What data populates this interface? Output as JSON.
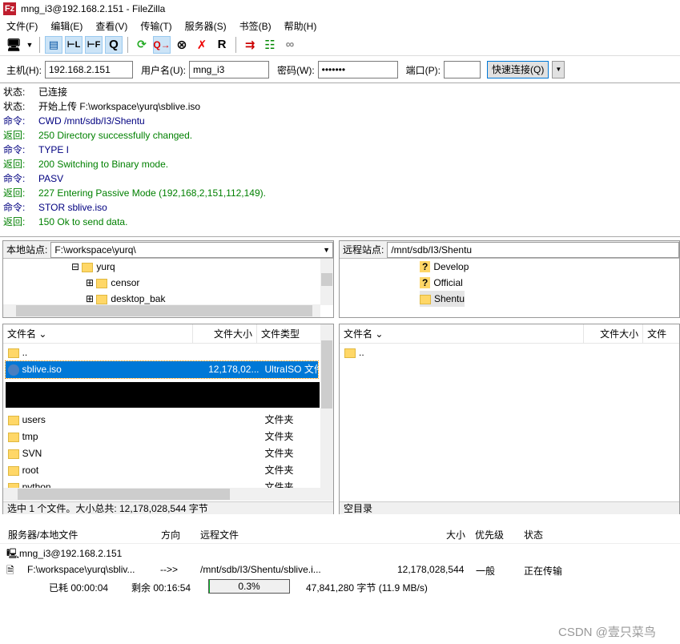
{
  "window": {
    "title": "mng_i3@192.168.2.151 - FileZilla",
    "logo": "Fz"
  },
  "menu": [
    "文件(F)",
    "编辑(E)",
    "查看(V)",
    "传输(T)",
    "服务器(S)",
    "书签(B)",
    "帮助(H)"
  ],
  "toolbar": {
    "icons": [
      "site-manager-icon",
      "dropdown-icon",
      "toggle-log-icon",
      "toggle-local-tree-icon",
      "toggle-remote-tree-icon",
      "toggle-queue-icon",
      "refresh-icon",
      "process-queue-icon",
      "cancel-icon",
      "disconnect-icon",
      "reconnect-icon",
      "compare-icon",
      "sync-browse-icon",
      "search-icon"
    ],
    "q_label": "Q",
    "r_label": "R"
  },
  "quickconnect": {
    "host_label": "主机(H):",
    "host": "192.168.2.151",
    "user_label": "用户名(U):",
    "user": "mng_i3",
    "pass_label": "密码(W):",
    "pass": "•••••••",
    "port_label": "端口(P):",
    "port": "",
    "button": "快速连接(Q)"
  },
  "log": [
    {
      "k": "状态:",
      "t": "已连接",
      "type": "status"
    },
    {
      "k": "状态:",
      "t": "开始上传 F:\\workspace\\yurq\\sblive.iso",
      "type": "status"
    },
    {
      "k": "命令:",
      "t": "CWD /mnt/sdb/I3/Shentu",
      "type": "cmd"
    },
    {
      "k": "返回:",
      "t": "250 Directory successfully changed.",
      "type": "ret"
    },
    {
      "k": "命令:",
      "t": "TYPE I",
      "type": "cmd"
    },
    {
      "k": "返回:",
      "t": "200 Switching to Binary mode.",
      "type": "ret"
    },
    {
      "k": "命令:",
      "t": "PASV",
      "type": "cmd"
    },
    {
      "k": "返回:",
      "t": "227 Entering Passive Mode (192,168,2,151,112,149).",
      "type": "ret"
    },
    {
      "k": "命令:",
      "t": "STOR sblive.iso",
      "type": "cmd"
    },
    {
      "k": "返回:",
      "t": "150 Ok to send data.",
      "type": "ret"
    }
  ],
  "local": {
    "site_label": "本地站点:",
    "path": "F:\\workspace\\yurq\\",
    "tree": [
      "yurq",
      "censor",
      "desktop_bak"
    ],
    "columns": [
      "文件名",
      "文件大小",
      "文件类型"
    ],
    "files": [
      {
        "name": "..",
        "size": "",
        "type": ""
      },
      {
        "name": "sblive.iso",
        "size": "12,178,02...",
        "type": "UltraISO 文件"
      },
      {
        "name": "users",
        "size": "",
        "type": "文件夹"
      },
      {
        "name": "tmp",
        "size": "",
        "type": "文件夹"
      },
      {
        "name": "SVN",
        "size": "",
        "type": "文件夹"
      },
      {
        "name": "root",
        "size": "",
        "type": "文件夹"
      },
      {
        "name": "python",
        "size": "",
        "type": "文件夹"
      }
    ],
    "status": "选中 1 个文件。大小总共: 12,178,028,544 字节"
  },
  "remote": {
    "site_label": "远程站点:",
    "path": "/mnt/sdb/I3/Shentu",
    "tree": [
      "Develop",
      "Official",
      "Shentu"
    ],
    "columns": [
      "文件名",
      "文件大小",
      "文件类"
    ],
    "files": [
      {
        "name": ".."
      }
    ],
    "status": "空目录"
  },
  "queue": {
    "columns": [
      "服务器/本地文件",
      "方向",
      "远程文件",
      "大小",
      "优先级",
      "状态"
    ],
    "server": "mng_i3@192.168.2.151",
    "item": {
      "local": "F:\\workspace\\yurq\\sbliv...",
      "dir": "-->>",
      "remote": "/mnt/sdb/I3/Shentu/sblive.i...",
      "size": "12,178,028,544",
      "priority": "一般",
      "status": "正在传输"
    },
    "elapsed": "已耗 00:00:04",
    "remaining": "剩余 00:16:54",
    "progress_text": "0.3%",
    "progress": 0.3,
    "bytes": "47,841,280 字节 (11.9 MB/s)"
  },
  "watermark": "CSDN @壹只菜鸟"
}
